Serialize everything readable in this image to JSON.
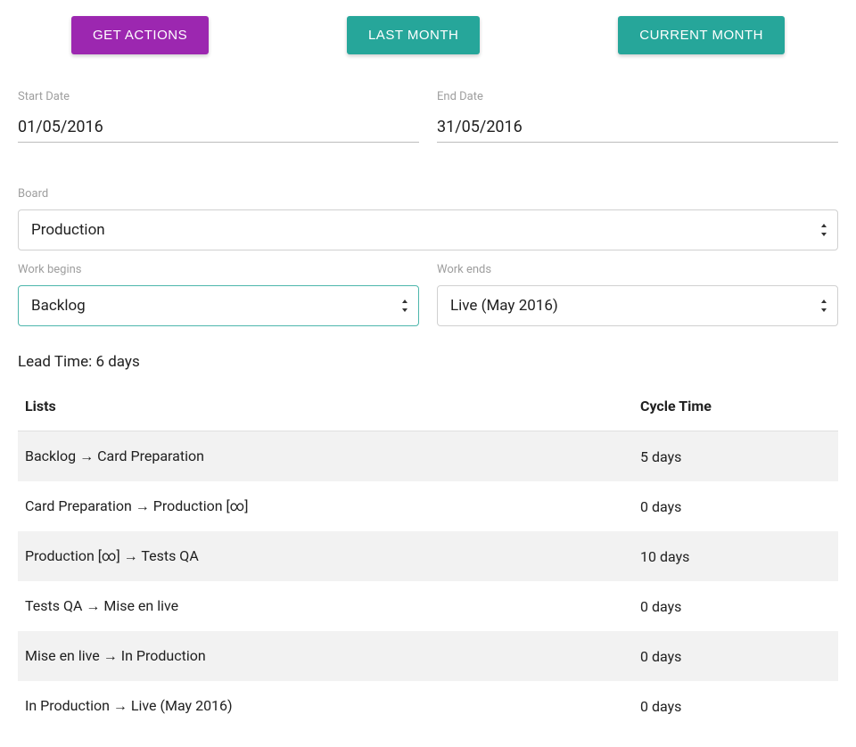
{
  "buttons": {
    "get_actions": "GET ACTIONS",
    "last_month": "LAST MONTH",
    "current_month": "CURRENT MONTH"
  },
  "dates": {
    "start_label": "Start Date",
    "start_value": "01/05/2016",
    "end_label": "End Date",
    "end_value": "31/05/2016"
  },
  "board": {
    "label": "Board",
    "value": "Production"
  },
  "work_begins": {
    "label": "Work begins",
    "value": "Backlog"
  },
  "work_ends": {
    "label": "Work ends",
    "value": "Live (May 2016)"
  },
  "lead_time": {
    "label": "Lead Time: ",
    "value": "6 days"
  },
  "table": {
    "headers": {
      "lists": "Lists",
      "cycle_time": "Cycle Time"
    },
    "arrow": " → ",
    "rows": [
      {
        "from": "Backlog",
        "to": "Card Preparation",
        "cycle": "5 days"
      },
      {
        "from": "Card Preparation",
        "to": "Production [∞]",
        "cycle": "0 days"
      },
      {
        "from": "Production [∞]",
        "to": "Tests QA",
        "cycle": "10 days"
      },
      {
        "from": "Tests QA",
        "to": "Mise en live",
        "cycle": "0 days"
      },
      {
        "from": "Mise en live",
        "to": "In Production",
        "cycle": "0 days"
      },
      {
        "from": "In Production",
        "to": "Live (May 2016)",
        "cycle": "0 days"
      }
    ]
  }
}
